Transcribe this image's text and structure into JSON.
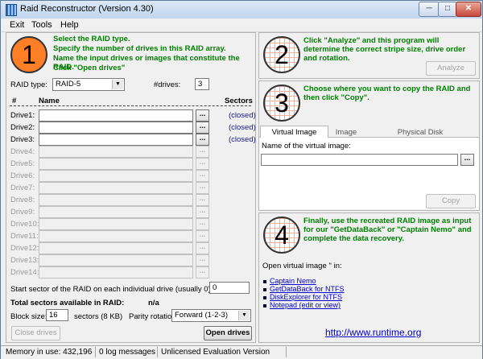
{
  "window": {
    "title": "Raid Reconstructor (Version 4.30)",
    "controls": {
      "minimize": "─",
      "maximize": "□",
      "close": "✕"
    }
  },
  "menu": [
    "Exit",
    "Tools",
    "Help"
  ],
  "step1": {
    "number": "1",
    "instructions": [
      "Select the RAID type.",
      "Specify the number of drives in this RAID array.",
      "Name the input drives or images that constitute the RAID.",
      "Click \"Open drives\""
    ],
    "raid_type_label": "RAID type:",
    "raid_type_value": "RAID-5",
    "drives_label": "#drives:",
    "drives_value": "3",
    "col_hash": "#",
    "col_name": "Name",
    "col_sectors": "Sectors",
    "drives": [
      {
        "label": "Drive1:",
        "status": "(closed)"
      },
      {
        "label": "Drive2:",
        "status": "(closed)"
      },
      {
        "label": "Drive3:",
        "status": "(closed)"
      },
      {
        "label": "Drive4:",
        "status": ""
      },
      {
        "label": "Drive5:",
        "status": ""
      },
      {
        "label": "Drive6:",
        "status": ""
      },
      {
        "label": "Drive7:",
        "status": ""
      },
      {
        "label": "Drive8:",
        "status": ""
      },
      {
        "label": "Drive9:",
        "status": ""
      },
      {
        "label": "Drive10:",
        "status": ""
      },
      {
        "label": "Drive11:",
        "status": ""
      },
      {
        "label": "Drive12:",
        "status": ""
      },
      {
        "label": "Drive13:",
        "status": ""
      },
      {
        "label": "Drive14:",
        "status": ""
      }
    ],
    "active_drive_count": 3,
    "browse_label": "...",
    "start_sector_label": "Start sector of the RAID on each individual drive (usually 0):",
    "start_sector_value": "0",
    "total_sectors_label": "Total sectors available in RAID:",
    "total_sectors_value": "n/a",
    "block_size_label": "Block size:",
    "block_size_value": "16",
    "block_size_suffix": "sectors (8 KB)",
    "parity_label": "Parity rotation:",
    "parity_value": "Forward (1-2-3)",
    "close_drives_label": "Close drives",
    "open_drives_label": "Open drives"
  },
  "step2": {
    "number": "2",
    "instruction": "Click \"Analyze\" and this program will determine the correct stripe size, drive order and rotation.",
    "analyze_label": "Analyze"
  },
  "step3": {
    "number": "3",
    "instruction": "Choose where you want to copy the RAID and then click \"Copy\".",
    "tabs": [
      "Virtual Image",
      "Image",
      "Physical Disk"
    ],
    "virtual_image_label": "Name of the virtual image:",
    "virtual_image_value": "",
    "browse_label": "...",
    "copy_label": "Copy"
  },
  "step4": {
    "number": "4",
    "instruction": "Finally, use the recreated RAID image as input for our \"GetDataBack\" or \"Captain Nemo\" and complete the data recovery.",
    "open_label": "Open virtual image '' in:",
    "links": [
      "Captain Nemo",
      "GetDataBack for NTFS",
      "DiskExplorer for NTFS",
      "Notepad (edit or view)"
    ],
    "website": "http://www.runtime.org"
  },
  "status": {
    "memory": "Memory in use: 432,196",
    "log": "0 log messages",
    "license": "Unlicensed Evaluation Version"
  }
}
